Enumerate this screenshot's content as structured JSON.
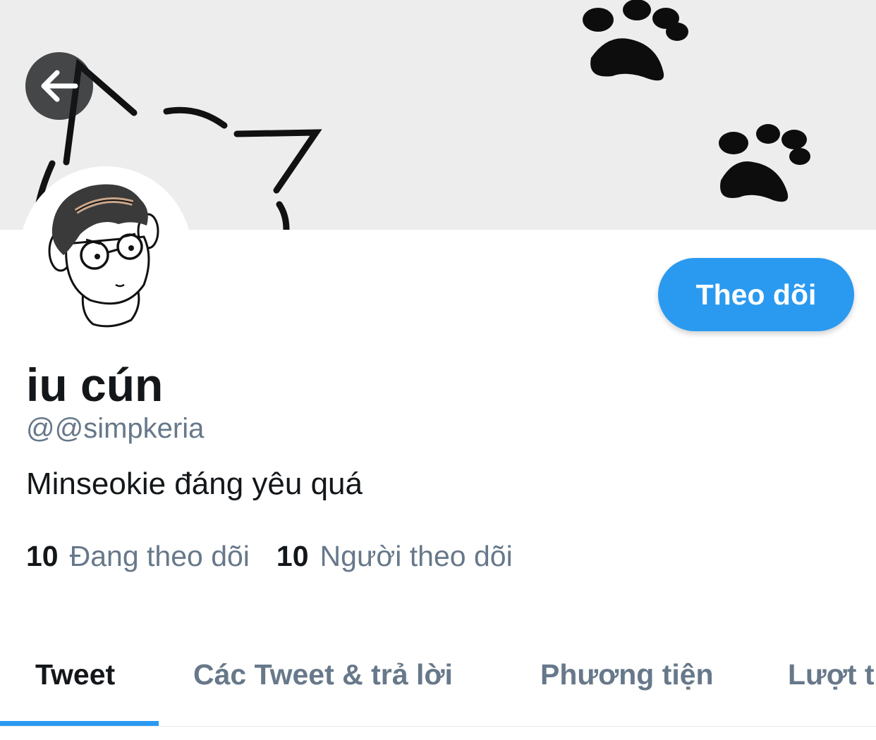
{
  "header": {
    "banner_icon": "cat-and-paw-prints-illustration",
    "back_icon": "arrow-left-icon"
  },
  "profile": {
    "avatar_icon": "cartoon-boy-with-glasses-avatar",
    "display_name": "iu cún",
    "handle": "@@simpkeria",
    "bio": "Minseokie đáng yêu quá",
    "follow_label": "Theo dõi",
    "following_count": "10",
    "following_label": "Đang theo dõi",
    "followers_count": "10",
    "followers_label": "Người theo dõi"
  },
  "tabs": [
    {
      "label": "Tweet",
      "active": true
    },
    {
      "label": "Các Tweet & trả lời",
      "active": false
    },
    {
      "label": "Phương tiện",
      "active": false
    },
    {
      "label": "Lượt t",
      "active": false
    }
  ],
  "colors": {
    "accent": "#2a9af0",
    "text_primary": "#14171a",
    "text_secondary": "#67788a",
    "banner_bg": "#ededee"
  }
}
